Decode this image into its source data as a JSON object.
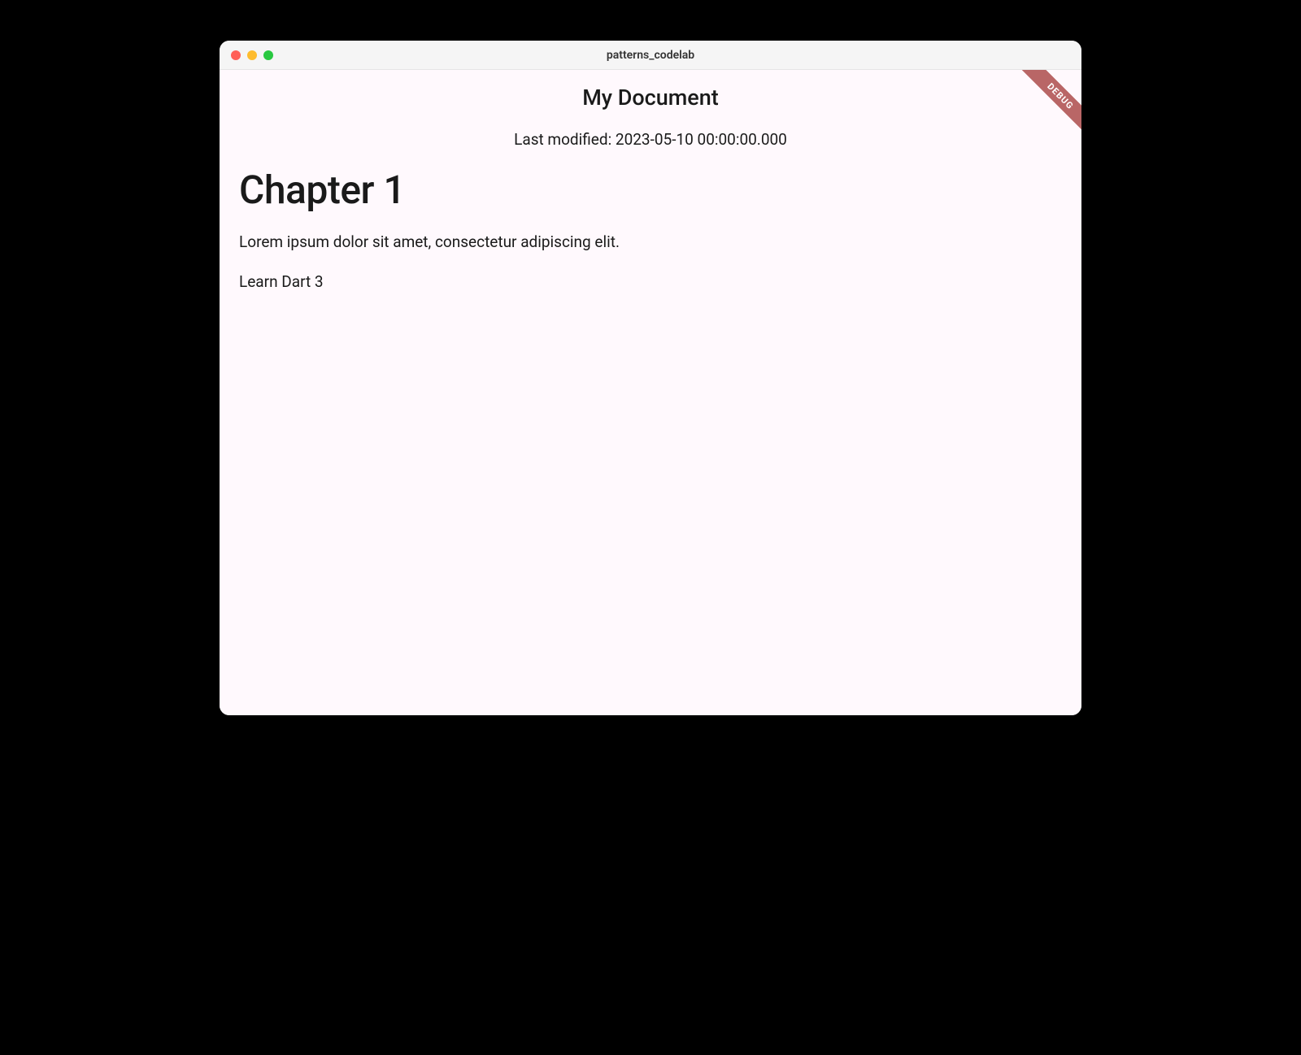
{
  "window": {
    "title": "patterns_codelab"
  },
  "debug_banner": "DEBUG",
  "header": {
    "title": "My Document",
    "last_modified": "Last modified: 2023-05-10 00:00:00.000"
  },
  "content": {
    "heading": "Chapter 1",
    "paragraph": "Lorem ipsum dolor sit amet, consectetur adipiscing elit.",
    "item": "Learn Dart 3"
  }
}
